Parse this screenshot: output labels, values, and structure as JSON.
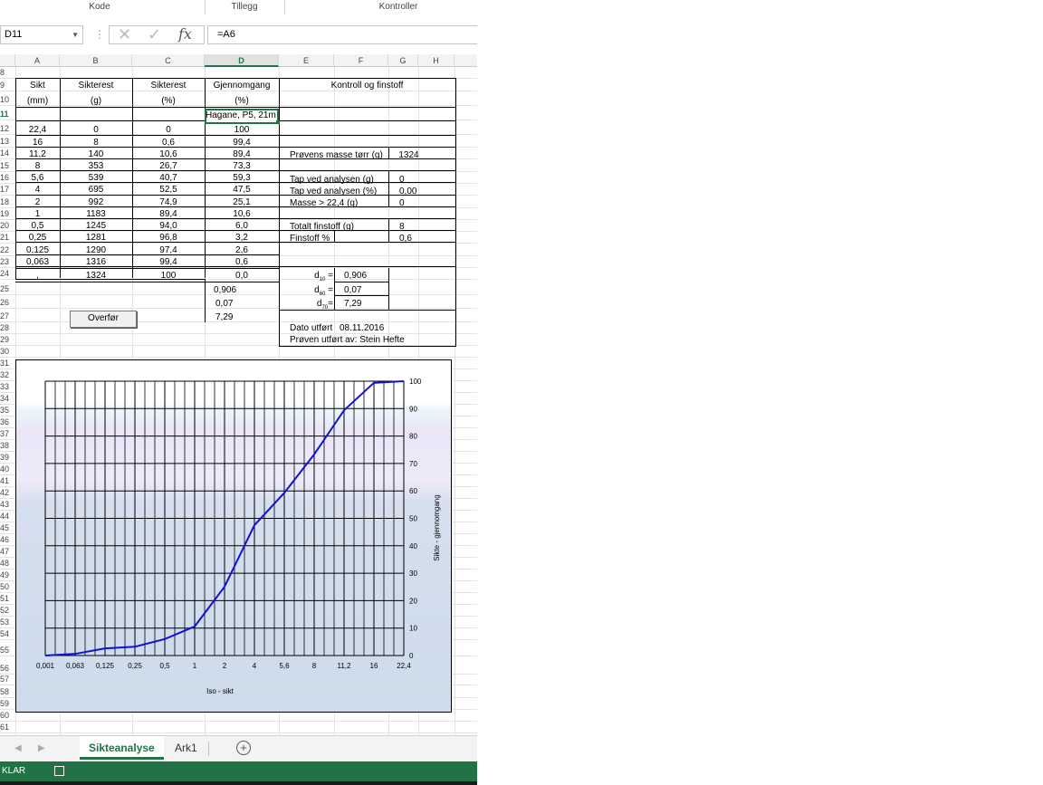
{
  "ribbon": {
    "groups": [
      "Kode",
      "Tillegg",
      "Kontroller"
    ]
  },
  "formula_bar": {
    "name_box": "D11",
    "formula": "=A6",
    "fx": "fx"
  },
  "columns": [
    "A",
    "B",
    "C",
    "D",
    "E",
    "F",
    "G",
    "H"
  ],
  "rows": [
    "8",
    "9",
    "10",
    "11",
    "12",
    "13",
    "14",
    "15",
    "16",
    "17",
    "18",
    "19",
    "20",
    "21",
    "22",
    "23",
    "24",
    "25",
    "26",
    "27",
    "28",
    "29",
    "30",
    "31",
    "32",
    "33",
    "34",
    "35",
    "36",
    "37",
    "38",
    "39",
    "40",
    "41",
    "42",
    "43",
    "44",
    "45",
    "46",
    "47",
    "48",
    "49",
    "50",
    "51",
    "52",
    "53",
    "54",
    "55",
    "56",
    "57",
    "58",
    "59",
    "60",
    "61"
  ],
  "table": {
    "headers": [
      "Sikt",
      "Sikterest",
      "Sikterest",
      "Gjennomgang"
    ],
    "units": [
      "(mm)",
      "(g)",
      "(%)",
      "(%)"
    ],
    "d11": "Hagane, P5, 21m",
    "rows": [
      [
        "22,4",
        "0",
        "0",
        "100"
      ],
      [
        "16",
        "8",
        "0,6",
        "99,4"
      ],
      [
        "11,2",
        "140",
        "10,6",
        "89,4"
      ],
      [
        "8",
        "353",
        "26,7",
        "73,3"
      ],
      [
        "5,6",
        "539",
        "40,7",
        "59,3"
      ],
      [
        "4",
        "695",
        "52,5",
        "47,5"
      ],
      [
        "2",
        "992",
        "74,9",
        "25,1"
      ],
      [
        "1",
        "1183",
        "89,4",
        "10,6"
      ],
      [
        "0,5",
        "1245",
        "94,0",
        "6,0"
      ],
      [
        "0,25",
        "1281",
        "96,8",
        "3,2"
      ],
      [
        "0,125",
        "1290",
        "97,4",
        "2,6"
      ],
      [
        "0,063",
        "1316",
        "99,4",
        "0,6"
      ],
      [
        ",",
        "1324",
        "100",
        "0,0"
      ]
    ],
    "d_extra": [
      "0,906",
      "0,07",
      "7,29"
    ]
  },
  "control": {
    "title": "Kontroll og finstoff",
    "items": [
      {
        "label": "Prøvens masse tørr (g)",
        "value": "1324"
      },
      {
        "label": "Tap ved analysen (g)",
        "value": "0"
      },
      {
        "label": "Tap ved analysen (%)",
        "value": "0,00"
      },
      {
        "label": "Masse > 22,4 (g)",
        "value": "0"
      },
      {
        "label": "Totalt finstoff (g)",
        "value": "8"
      },
      {
        "label": "Finstoff %",
        "value": "0,6"
      }
    ],
    "d_values": [
      {
        "label": "d",
        "sub": "10",
        "value": "0,906"
      },
      {
        "label": "d",
        "sub": "60",
        "value": "0,07"
      },
      {
        "label": "d",
        "sub": "70",
        "value": "7,29"
      }
    ],
    "date_label": "Dato utført",
    "date_value": "08.11.2016",
    "done_by": "Prøven utført av: Stein Hefte"
  },
  "button_label": "Overfør",
  "chart_data": {
    "type": "line",
    "x": [
      "0,001",
      "0,063",
      "0,125",
      "0,25",
      "0,5",
      "1",
      "2",
      "4",
      "5,6",
      "8",
      "11,2",
      "16",
      "22,4"
    ],
    "series": [
      {
        "values": [
          0,
          0.6,
          2.6,
          3.2,
          6.0,
          10.6,
          25.1,
          47.5,
          59.3,
          73.3,
          89.4,
          99.4,
          100
        ]
      }
    ],
    "xlabel": "Iso - sikt",
    "ylabel": "Sikte - gjennomgang",
    "ylim": [
      0,
      100
    ],
    "yticks": [
      "0",
      "10",
      "20",
      "30",
      "40",
      "50",
      "60",
      "70",
      "80",
      "90",
      "100"
    ],
    "grid": true,
    "line_color": "#1010d8"
  },
  "sheet_tabs": [
    "Sikteanalyse",
    "Ark1"
  ],
  "status": {
    "text": "KLAR"
  }
}
